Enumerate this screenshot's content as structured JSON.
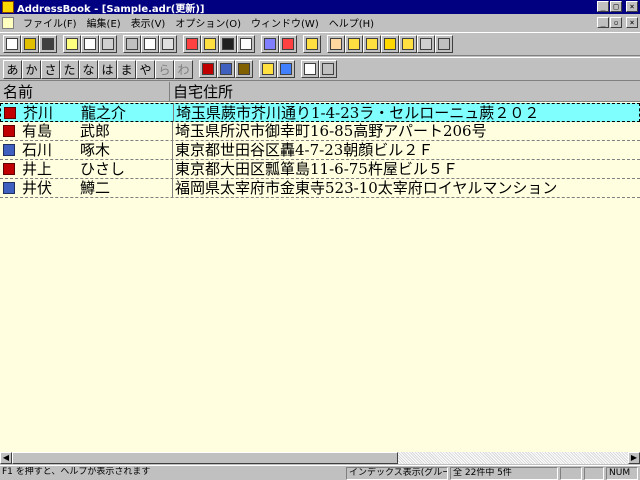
{
  "window": {
    "title": "AddressBook - [Sample.adr(更新)]"
  },
  "menu": [
    "ファイル(F)",
    "編集(E)",
    "表示(V)",
    "オプション(O)",
    "ウィンドウ(W)",
    "ヘルプ(H)"
  ],
  "kana_index": [
    "あ",
    "か",
    "さ",
    "た",
    "な",
    "は",
    "ま",
    "や",
    "ら",
    "わ"
  ],
  "list": {
    "headers": {
      "name": "名前",
      "address": "自宅住所"
    },
    "rows": [
      {
        "icon": "mail-icon",
        "surname": "芥川",
        "given": "龍之介",
        "address": "埼玉県蕨市芥川通り1-4-23ラ・セルローニュ蕨２０２",
        "selected": true
      },
      {
        "icon": "mail-icon",
        "surname": "有島",
        "given": "武郎",
        "address": "埼玉県所沢市御幸町16-85高野アパート206号",
        "selected": false
      },
      {
        "icon": "fax-icon",
        "surname": "石川",
        "given": "啄木",
        "address": "東京都世田谷区轟4-7-23朝顔ビル２Ｆ",
        "selected": false
      },
      {
        "icon": "mail-icon",
        "surname": "井上",
        "given": "ひさし",
        "address": "東京都大田区瓢箪島11-6-75杵屋ビル５Ｆ",
        "selected": false
      },
      {
        "icon": "fax-icon",
        "surname": "井伏",
        "given": "鱒二",
        "address": "福岡県太宰府市金東寺523-10太宰府ロイヤルマンション",
        "selected": false
      }
    ]
  },
  "status": {
    "help": "F1 を押すと、ヘルプが表示されます",
    "index_mode": "インデックス表示(グループ)",
    "count": "全 22件中 5件",
    "num": "NUM"
  },
  "colors": {
    "titlebar": "#000080",
    "selection": "#80ffff",
    "list_bg": "#ffffe0"
  }
}
